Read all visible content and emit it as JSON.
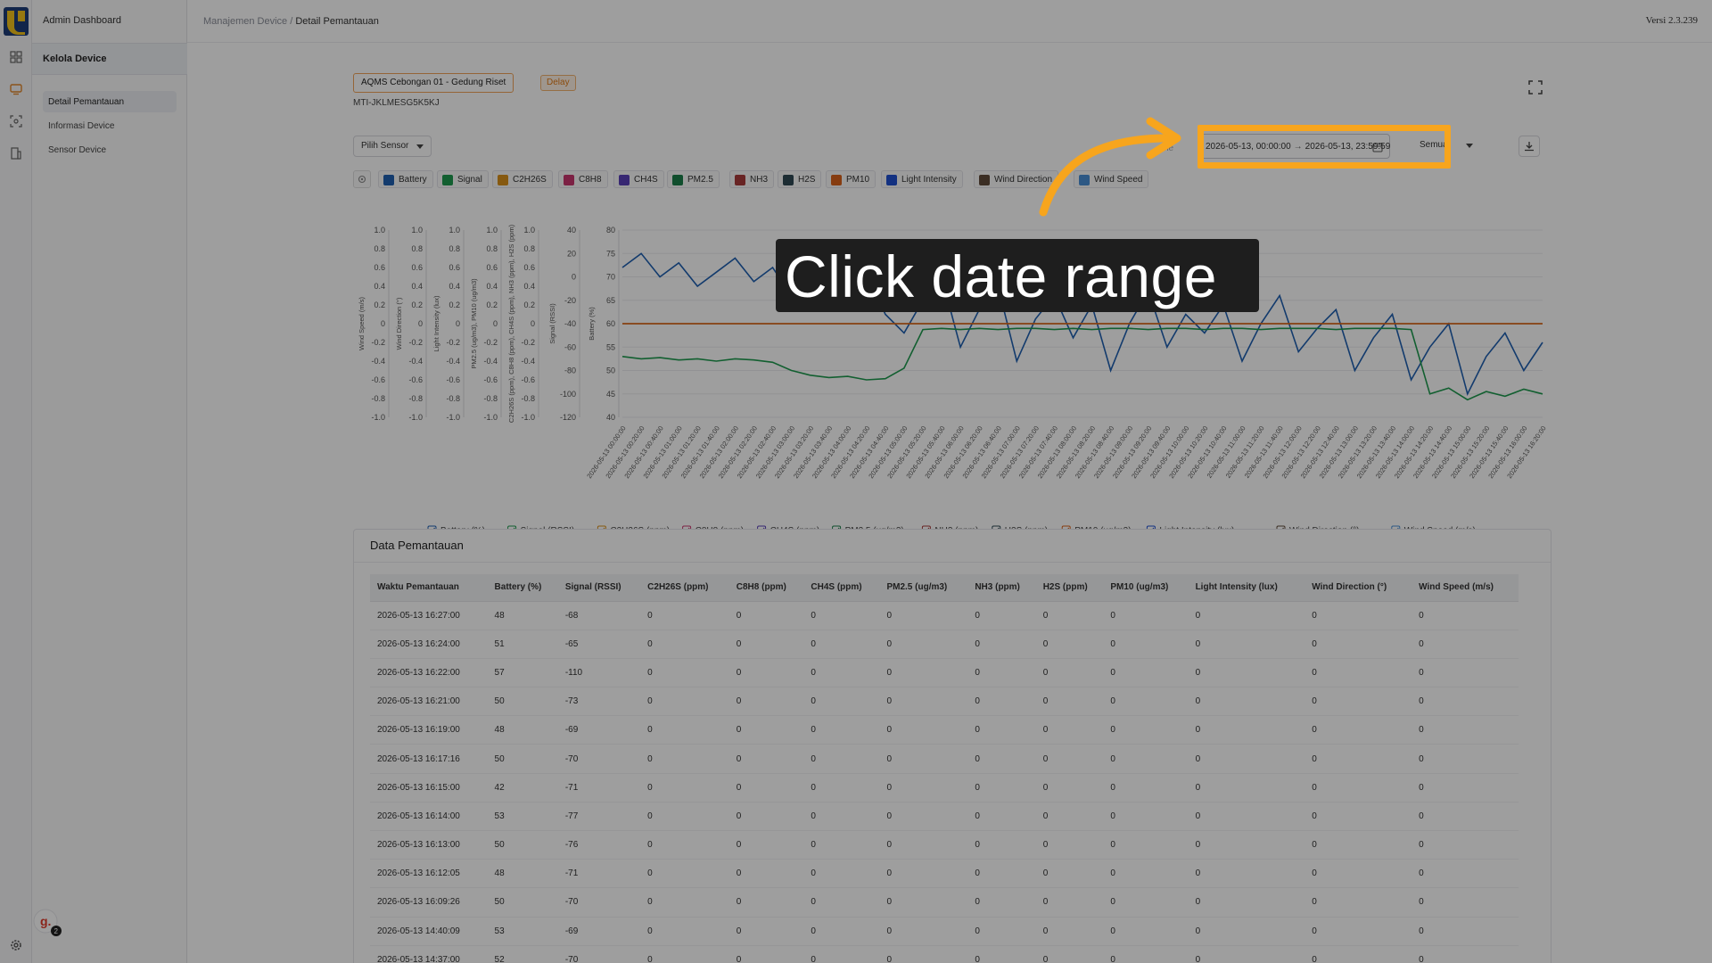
{
  "app": {
    "title": "Admin Dashboard",
    "version": "Versi 2.3.239"
  },
  "breadcrumb": {
    "parent": "Manajemen Device",
    "separator": " / ",
    "current": "Detail Pemantauan"
  },
  "sidebar": {
    "group_label": "Kelola Device",
    "items": [
      {
        "label": "Detail Pemantauan",
        "active": true
      },
      {
        "label": "Informasi Device",
        "active": false
      },
      {
        "label": "Sensor Device",
        "active": false
      }
    ],
    "user_badge_count": "2",
    "user_initial": "g."
  },
  "device": {
    "name": "AQMS Cebongan 01 - Gedung Riset",
    "status": "Delay",
    "id": "MTI-JKLMESG5K5KJ"
  },
  "toolbar": {
    "sensor_select": "Pilih Sensor",
    "faded_label": "ne",
    "date_start": "2026-05-13, 00:00:00",
    "date_arrow": "→",
    "date_end": "2026-05-13, 23:59:59",
    "aggregate_select": "Semua"
  },
  "legend_chips": [
    {
      "label": "Battery",
      "color": "#1f5fb0"
    },
    {
      "label": "Signal",
      "color": "#1e9a4e"
    },
    {
      "label": "C2H26S",
      "color": "#d9901a"
    },
    {
      "label": "C8H8",
      "color": "#c9366e"
    },
    {
      "label": "CH4S",
      "color": "#5a3fb8"
    },
    {
      "label": "PM2.5",
      "color": "#1b7f4a"
    },
    {
      "label": "NH3",
      "color": "#a83a3a"
    },
    {
      "label": "H2S",
      "color": "#2f4a55"
    },
    {
      "label": "PM10",
      "color": "#d9621a"
    },
    {
      "label": "Light Intensity",
      "color": "#1f4fd1"
    },
    {
      "label": "Wind Direction",
      "color": "#5f4b3b"
    },
    {
      "label": "Wind Speed",
      "color": "#4a8fd6"
    }
  ],
  "overlay": {
    "instruction": "Click date range",
    "highlight_color": "#f7a51d"
  },
  "chart_data": {
    "type": "line",
    "title": "",
    "axes": [
      {
        "label": "Wind Speed (m/s)",
        "ticks": [
          "1.0",
          "0.8",
          "0.6",
          "0.4",
          "0.2",
          "0",
          "-0.2",
          "-0.4",
          "-0.6",
          "-0.8",
          "-1.0"
        ]
      },
      {
        "label": "Wind Direction (°)",
        "ticks": [
          "1.0",
          "0.8",
          "0.6",
          "0.4",
          "0.2",
          "0",
          "-0.2",
          "-0.4",
          "-0.6",
          "-0.8",
          "-1.0"
        ]
      },
      {
        "label": "Light Intensity (lux)",
        "ticks": [
          "1.0",
          "0.8",
          "0.6",
          "0.4",
          "0.2",
          "0",
          "-0.2",
          "-0.4",
          "-0.6",
          "-0.8",
          "-1.0"
        ]
      },
      {
        "label": "PM2.5 (ug/m3), PM10 (ug/m3)",
        "ticks": [
          "1.0",
          "0.8",
          "0.6",
          "0.4",
          "0.2",
          "0",
          "-0.2",
          "-0.4",
          "-0.6",
          "-0.8",
          "-1.0"
        ]
      },
      {
        "label": "C2H26S (ppm), C8H8 (ppm), CH4S (ppm), NH3 (ppm), H2S (ppm)",
        "ticks": [
          "1.0",
          "0.8",
          "0.6",
          "0.4",
          "0.2",
          "0",
          "-0.2",
          "-0.4",
          "-0.6",
          "-0.8",
          "-1.0"
        ]
      },
      {
        "label": "Signal (RSSI)",
        "ticks": [
          "40",
          "20",
          "0",
          "-20",
          "-40",
          "-60",
          "-80",
          "-100",
          "-120"
        ]
      },
      {
        "label": "Battery (%)",
        "ticks": [
          "80",
          "75",
          "70",
          "65",
          "60",
          "55",
          "50",
          "45",
          "40"
        ]
      }
    ],
    "battery_ylim": [
      40,
      80
    ],
    "signal_ylim": [
      -120,
      40
    ],
    "x_labels": [
      "2026-05-13 00:00:00",
      "2026-05-13 00:20:00",
      "2026-05-13 00:40:00",
      "2026-05-13 01:00:00",
      "2026-05-13 01:20:00",
      "2026-05-13 01:40:00",
      "2026-05-13 02:00:00",
      "2026-05-13 02:20:00",
      "2026-05-13 02:40:00",
      "2026-05-13 03:00:00",
      "2026-05-13 03:20:00",
      "2026-05-13 03:40:00",
      "2026-05-13 04:00:00",
      "2026-05-13 04:20:00",
      "2026-05-13 04:40:00",
      "2026-05-13 05:00:00",
      "2026-05-13 05:20:00",
      "2026-05-13 05:40:00",
      "2026-05-13 06:00:00",
      "2026-05-13 06:20:00",
      "2026-05-13 06:40:00",
      "2026-05-13 07:00:00",
      "2026-05-13 07:20:00",
      "2026-05-13 07:40:00",
      "2026-05-13 08:00:00",
      "2026-05-13 08:20:00",
      "2026-05-13 08:40:00",
      "2026-05-13 09:00:00",
      "2026-05-13 09:20:00",
      "2026-05-13 09:40:00",
      "2026-05-13 10:00:00",
      "2026-05-13 10:20:00",
      "2026-05-13 10:40:00",
      "2026-05-13 11:00:00",
      "2026-05-13 11:20:00",
      "2026-05-13 11:40:00",
      "2026-05-13 12:00:00",
      "2026-05-13 12:20:00",
      "2026-05-13 12:40:00",
      "2026-05-13 13:00:00",
      "2026-05-13 13:20:00",
      "2026-05-13 13:40:00",
      "2026-05-13 14:00:00",
      "2026-05-13 14:20:00",
      "2026-05-13 14:40:00",
      "2026-05-13 15:00:00",
      "2026-05-13 15:20:00",
      "2026-05-13 15:40:00",
      "2026-05-13 16:00:00",
      "2026-05-13 16:20:00"
    ],
    "series": [
      {
        "name": "Battery (%)",
        "color": "#1f5fb0",
        "axis": "battery",
        "values": [
          72,
          75,
          70,
          73,
          68,
          71,
          74,
          69,
          72,
          66,
          70,
          73,
          67,
          71,
          62,
          58,
          65,
          70,
          55,
          63,
          68,
          52,
          61,
          66,
          57,
          64,
          50,
          60,
          67,
          55,
          62,
          58,
          64,
          52,
          60,
          66,
          54,
          59,
          63,
          50,
          57,
          62,
          48,
          55,
          60,
          45,
          53,
          58,
          50,
          56
        ]
      },
      {
        "name": "Signal (RSSI)",
        "color": "#1e9a4e",
        "axis": "signal",
        "values": [
          -68,
          -70,
          -69,
          -71,
          -70,
          -72,
          -70,
          -71,
          -73,
          -80,
          -84,
          -86,
          -85,
          -88,
          -87,
          -78,
          -45,
          -44,
          -45,
          -44,
          -45,
          -44,
          -44,
          -45,
          -44,
          -45,
          -44,
          -44,
          -45,
          -44,
          -44,
          -45,
          -44,
          -44,
          -45,
          -44,
          -44,
          -44,
          -45,
          -44,
          -44,
          -44,
          -45,
          -100,
          -95,
          -105,
          -98,
          -102,
          -96,
          -100
        ]
      },
      {
        "name": "C2H26S (ppm)",
        "color": "#d9901a",
        "axis": "gas",
        "values": [
          0,
          0,
          0,
          0,
          0,
          0,
          0,
          0,
          0,
          0,
          0,
          0,
          0,
          0,
          0,
          0,
          0,
          0,
          0,
          0,
          0,
          0,
          0,
          0,
          0,
          0,
          0,
          0,
          0,
          0,
          0,
          0,
          0,
          0,
          0,
          0,
          0,
          0,
          0,
          0,
          0,
          0,
          0,
          0,
          0,
          0,
          0,
          0,
          0,
          0
        ]
      },
      {
        "name": "PM10 (ug/m3)",
        "color": "#d9621a",
        "axis": "pm",
        "values": [
          0,
          0,
          0,
          0,
          0,
          0,
          0,
          0,
          0,
          0,
          0,
          0,
          0,
          0,
          0,
          0,
          0,
          0,
          0,
          0,
          0,
          0,
          0,
          0,
          0,
          0,
          0,
          0,
          0,
          0,
          0,
          0,
          0,
          0,
          0,
          0,
          0,
          0,
          0,
          0,
          0,
          0,
          0,
          0,
          0,
          0,
          0,
          0,
          0,
          0
        ]
      }
    ],
    "bottom_legend": [
      "Battery (%)",
      "Signal (RSSI)",
      "C2H26S (ppm)",
      "C8H8 (ppm)",
      "CH4S (ppm)",
      "PM2.5 (ug/m3)",
      "NH3 (ppm)",
      "H2S (ppm)",
      "PM10 (ug/m3)",
      "Light Intensity (lux)",
      "Wind Direction (°)",
      "Wind Speed (m/s)"
    ]
  },
  "table": {
    "title": "Data Pemantauan",
    "columns": [
      "Waktu Pemantauan",
      "Battery (%)",
      "Signal (RSSI)",
      "C2H26S (ppm)",
      "C8H8 (ppm)",
      "CH4S (ppm)",
      "PM2.5 (ug/m3)",
      "NH3 (ppm)",
      "H2S (ppm)",
      "PM10 (ug/m3)",
      "Light Intensity (lux)",
      "Wind Direction (°)",
      "Wind Speed (m/s)"
    ],
    "rows": [
      [
        "2026-05-13 16:27:00",
        "48",
        "-68",
        "0",
        "0",
        "0",
        "0",
        "0",
        "0",
        "0",
        "0",
        "0",
        "0"
      ],
      [
        "2026-05-13 16:24:00",
        "51",
        "-65",
        "0",
        "0",
        "0",
        "0",
        "0",
        "0",
        "0",
        "0",
        "0",
        "0"
      ],
      [
        "2026-05-13 16:22:00",
        "57",
        "-110",
        "0",
        "0",
        "0",
        "0",
        "0",
        "0",
        "0",
        "0",
        "0",
        "0"
      ],
      [
        "2026-05-13 16:21:00",
        "50",
        "-73",
        "0",
        "0",
        "0",
        "0",
        "0",
        "0",
        "0",
        "0",
        "0",
        "0"
      ],
      [
        "2026-05-13 16:19:00",
        "48",
        "-69",
        "0",
        "0",
        "0",
        "0",
        "0",
        "0",
        "0",
        "0",
        "0",
        "0"
      ],
      [
        "2026-05-13 16:17:16",
        "50",
        "-70",
        "0",
        "0",
        "0",
        "0",
        "0",
        "0",
        "0",
        "0",
        "0",
        "0"
      ],
      [
        "2026-05-13 16:15:00",
        "42",
        "-71",
        "0",
        "0",
        "0",
        "0",
        "0",
        "0",
        "0",
        "0",
        "0",
        "0"
      ],
      [
        "2026-05-13 16:14:00",
        "53",
        "-77",
        "0",
        "0",
        "0",
        "0",
        "0",
        "0",
        "0",
        "0",
        "0",
        "0"
      ],
      [
        "2026-05-13 16:13:00",
        "50",
        "-76",
        "0",
        "0",
        "0",
        "0",
        "0",
        "0",
        "0",
        "0",
        "0",
        "0"
      ],
      [
        "2026-05-13 16:12:05",
        "48",
        "-71",
        "0",
        "0",
        "0",
        "0",
        "0",
        "0",
        "0",
        "0",
        "0",
        "0"
      ],
      [
        "2026-05-13 16:09:26",
        "50",
        "-70",
        "0",
        "0",
        "0",
        "0",
        "0",
        "0",
        "0",
        "0",
        "0",
        "0"
      ],
      [
        "2026-05-13 14:40:09",
        "53",
        "-69",
        "0",
        "0",
        "0",
        "0",
        "0",
        "0",
        "0",
        "0",
        "0",
        "0"
      ],
      [
        "2026-05-13 14:37:00",
        "52",
        "-70",
        "0",
        "0",
        "0",
        "0",
        "0",
        "0",
        "0",
        "0",
        "0",
        "0"
      ]
    ]
  }
}
